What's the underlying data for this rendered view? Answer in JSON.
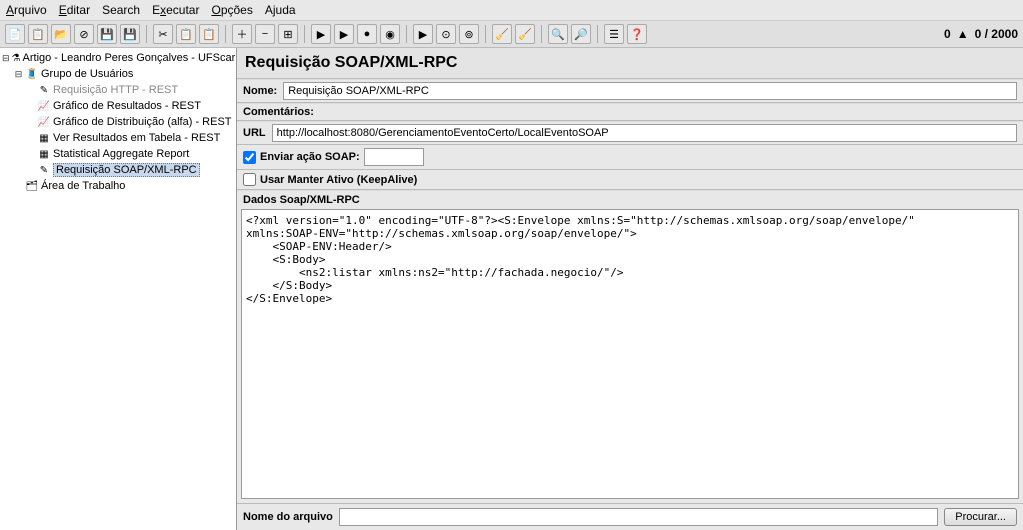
{
  "menu": {
    "arquivo": "Arquivo",
    "editar": "Editar",
    "search": "Search",
    "executar": "Executar",
    "opcoes": "Opções",
    "ajuda": "Ajuda"
  },
  "toolbar_status": {
    "errors": "0",
    "counter": "0 / 2000"
  },
  "tree": {
    "root": "Artigo - Leandro Peres Gonçalves - UFScar",
    "grupo": "Grupo de Usuários",
    "req_http": "Requisição HTTP - REST",
    "grafico_res": "Gráfico de Resultados - REST",
    "grafico_dist": "Gráfico de Distribuição (alfa) - REST",
    "ver_res": "Ver Resultados em Tabela - REST",
    "stat_agg": "Statistical Aggregate Report",
    "req_soap": "Requisição SOAP/XML-RPC",
    "area": "Área de Trabalho"
  },
  "panel": {
    "title": "Requisição SOAP/XML-RPC",
    "nome_label": "Nome:",
    "nome_value": "Requisição SOAP/XML-RPC",
    "comentarios_label": "Comentários:",
    "url_label": "URL",
    "url_value": "http://localhost:8080/GerenciamentoEventoCerto/LocalEventoSOAP",
    "envio_label": "Enviar ação SOAP:",
    "envio_value": "",
    "keepalive_label": "Usar Manter Ativo (KeepAlive)",
    "dados_label": "Dados Soap/XML-RPC",
    "xml": "<?xml version=\"1.0\" encoding=\"UTF-8\"?><S:Envelope xmlns:S=\"http://schemas.xmlsoap.org/soap/envelope/\"\nxmlns:SOAP-ENV=\"http://schemas.xmlsoap.org/soap/envelope/\">\n    <SOAP-ENV:Header/>\n    <S:Body>\n        <ns2:listar xmlns:ns2=\"http://fachada.negocio/\"/>\n    </S:Body>\n</S:Envelope>",
    "nome_arquivo_label": "Nome do arquivo",
    "nome_arquivo_value": "",
    "procurar": "Procurar..."
  }
}
